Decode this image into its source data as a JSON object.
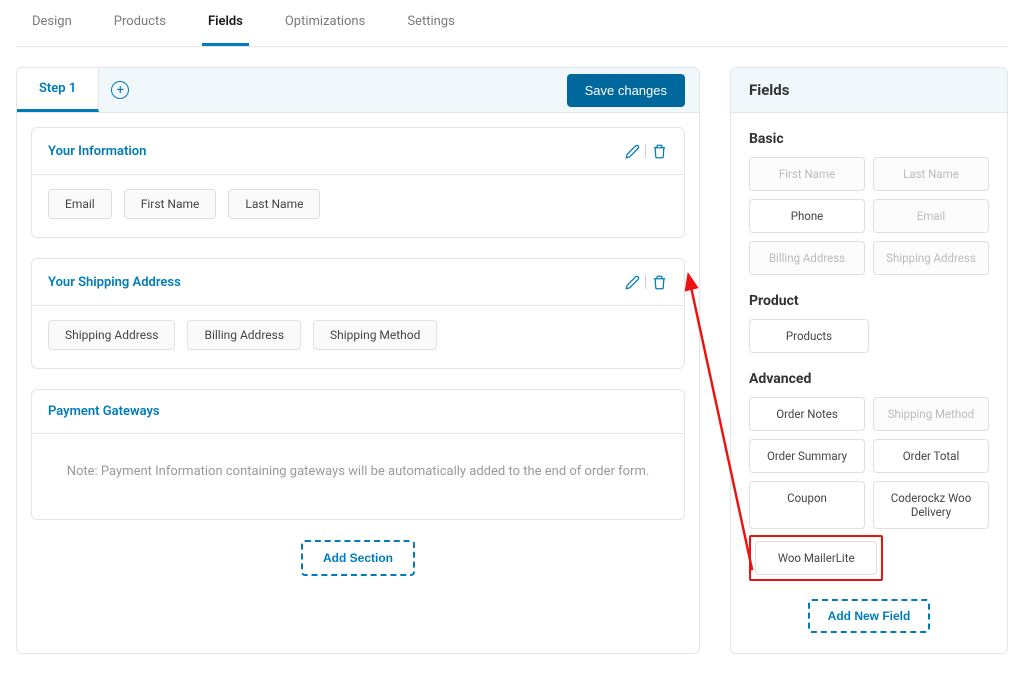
{
  "tabs": {
    "items": [
      "Design",
      "Products",
      "Fields",
      "Optimizations",
      "Settings"
    ],
    "active": "Fields"
  },
  "step": {
    "tab_label": "Step 1",
    "save_label": "Save changes"
  },
  "sections": [
    {
      "title": "Your Information",
      "fields": [
        "Email",
        "First Name",
        "Last Name"
      ]
    },
    {
      "title": "Your Shipping Address",
      "fields": [
        "Shipping Address",
        "Billing Address",
        "Shipping Method"
      ]
    },
    {
      "title": "Payment Gateways",
      "note": "Note: Payment Information containing gateways will be automatically added to the end of order form."
    }
  ],
  "add_section_label": "Add Section",
  "sidebar": {
    "title": "Fields",
    "basic": {
      "title": "Basic",
      "items": [
        {
          "label": "First Name",
          "disabled": true
        },
        {
          "label": "Last Name",
          "disabled": true
        },
        {
          "label": "Phone",
          "disabled": false
        },
        {
          "label": "Email",
          "disabled": true
        },
        {
          "label": "Billing Address",
          "disabled": true
        },
        {
          "label": "Shipping Address",
          "disabled": true
        }
      ]
    },
    "product": {
      "title": "Product",
      "items": [
        {
          "label": "Products",
          "disabled": false
        }
      ]
    },
    "advanced": {
      "title": "Advanced",
      "items": [
        {
          "label": "Order Notes",
          "disabled": false
        },
        {
          "label": "Shipping Method",
          "disabled": true
        },
        {
          "label": "Order Summary",
          "disabled": false
        },
        {
          "label": "Order Total",
          "disabled": false
        },
        {
          "label": "Coupon",
          "disabled": false
        },
        {
          "label": "Coderockz Woo Delivery",
          "disabled": false
        }
      ],
      "highlighted": {
        "label": "Woo MailerLite"
      }
    },
    "add_field_label": "Add New Field"
  }
}
